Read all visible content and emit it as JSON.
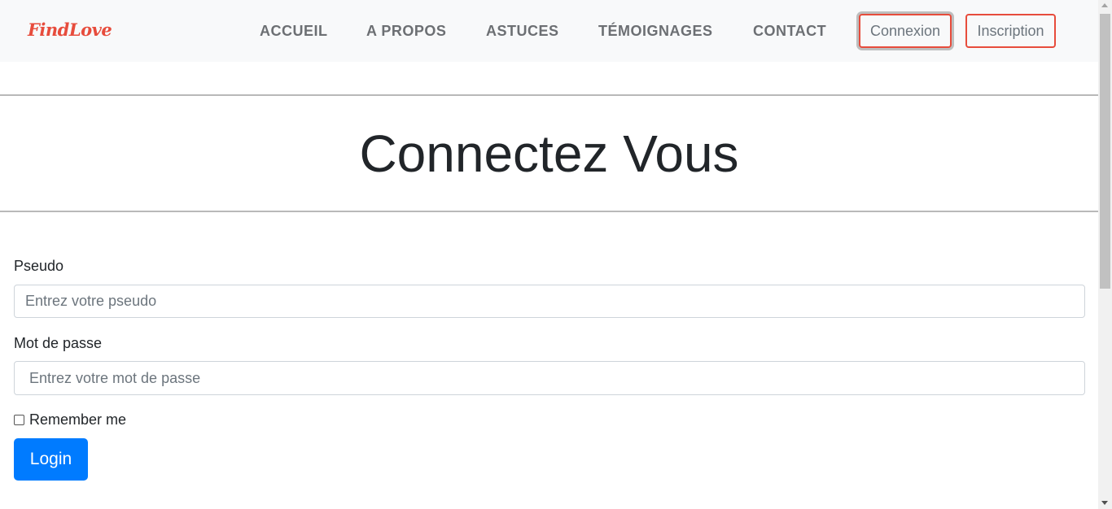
{
  "navbar": {
    "brand": "FindLove",
    "links": [
      "ACCUEIL",
      "A PROPOS",
      "ASTUCES",
      "TÉMOIGNAGES",
      "CONTACT"
    ],
    "login_button": "Connexion",
    "signup_button": "Inscription"
  },
  "header": {
    "title": "Connectez Vous"
  },
  "form": {
    "pseudo_label": "Pseudo",
    "pseudo_placeholder": "Entrez votre pseudo",
    "password_label": "Mot de passe",
    "password_placeholder": "Entrez votre mot de passe",
    "remember_label": "Remember me",
    "remember_checked": false,
    "submit_label": "Login"
  },
  "colors": {
    "brand": "#e74c3c",
    "primary": "#007bff",
    "navbar_bg": "#f8f9fa",
    "nav_text": "#6c6f73"
  },
  "icons": {
    "scroll_up": "triangle-up",
    "scroll_down": "triangle-down"
  }
}
